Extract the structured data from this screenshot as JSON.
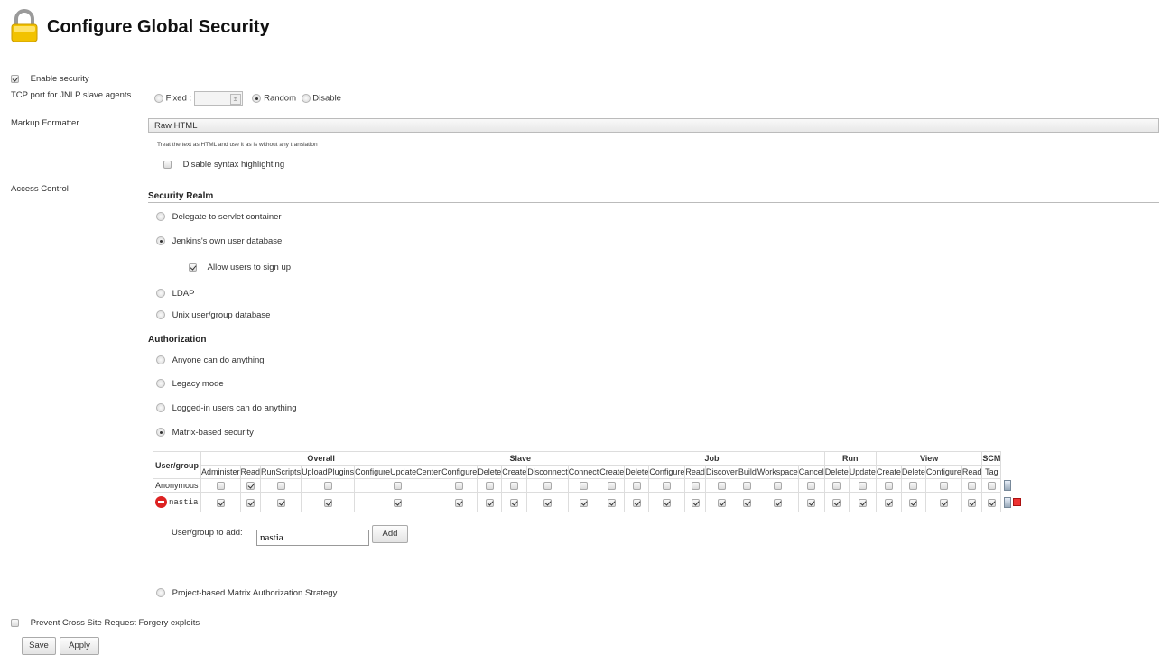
{
  "page": {
    "title": "Configure Global Security"
  },
  "enable_security": {
    "label": "Enable security",
    "checked": true
  },
  "tcp_port": {
    "label": "TCP port for JNLP slave agents",
    "fixed_label": "Fixed :",
    "fixed_value": "",
    "random_label": "Random",
    "disable_label": "Disable",
    "selected": "Random"
  },
  "markup": {
    "label": "Markup Formatter",
    "selected": "Raw HTML",
    "description": "Treat the text as HTML and use it as is without any translation",
    "disable_highlight_label": "Disable syntax highlighting"
  },
  "access": {
    "label": "Access Control",
    "realm_heading": "Security Realm",
    "realm_options": [
      "Delegate to servlet container",
      "Jenkins's own user database",
      "LDAP",
      "Unix user/group database"
    ],
    "realm_selected": "Jenkins's own user database",
    "allow_signup_label": "Allow users to sign up",
    "authz_heading": "Authorization",
    "authz_options": [
      "Anyone can do anything",
      "Legacy mode",
      "Logged-in users can do anything",
      "Matrix-based security"
    ],
    "authz_selected": "Matrix-based security",
    "project_matrix_label": "Project-based Matrix Authorization Strategy"
  },
  "matrix": {
    "usergroup_header": "User/group",
    "groups": [
      {
        "name": "Overall",
        "perms": [
          "Administer",
          "Read",
          "RunScripts",
          "UploadPlugins",
          "ConfigureUpdateCenter"
        ]
      },
      {
        "name": "Slave",
        "perms": [
          "Configure",
          "Delete",
          "Create",
          "Disconnect",
          "Connect"
        ]
      },
      {
        "name": "Job",
        "perms": [
          "Create",
          "Delete",
          "Configure",
          "Read",
          "Discover",
          "Build",
          "Workspace",
          "Cancel"
        ]
      },
      {
        "name": "Run",
        "perms": [
          "Delete",
          "Update"
        ]
      },
      {
        "name": "View",
        "perms": [
          "Create",
          "Delete",
          "Configure",
          "Read"
        ]
      },
      {
        "name": "SCM",
        "perms": [
          "Tag"
        ]
      }
    ],
    "rows": [
      {
        "name": "Anonymous",
        "checked": [
          false,
          true,
          false,
          false,
          false,
          false,
          false,
          false,
          false,
          false,
          false,
          false,
          false,
          false,
          false,
          false,
          false,
          false,
          false,
          false,
          false,
          false,
          false,
          false,
          false
        ]
      },
      {
        "name": "nastia",
        "checked": [
          true,
          true,
          true,
          true,
          true,
          true,
          true,
          true,
          true,
          true,
          true,
          true,
          true,
          true,
          true,
          true,
          true,
          true,
          true,
          true,
          true,
          true,
          true,
          true,
          true
        ]
      }
    ],
    "add_label": "User/group to add:",
    "add_value": "nastia",
    "add_button": "Add"
  },
  "csrf": {
    "label": "Prevent Cross Site Request Forgery exploits",
    "checked": false
  },
  "buttons": {
    "save": "Save",
    "apply": "Apply"
  }
}
